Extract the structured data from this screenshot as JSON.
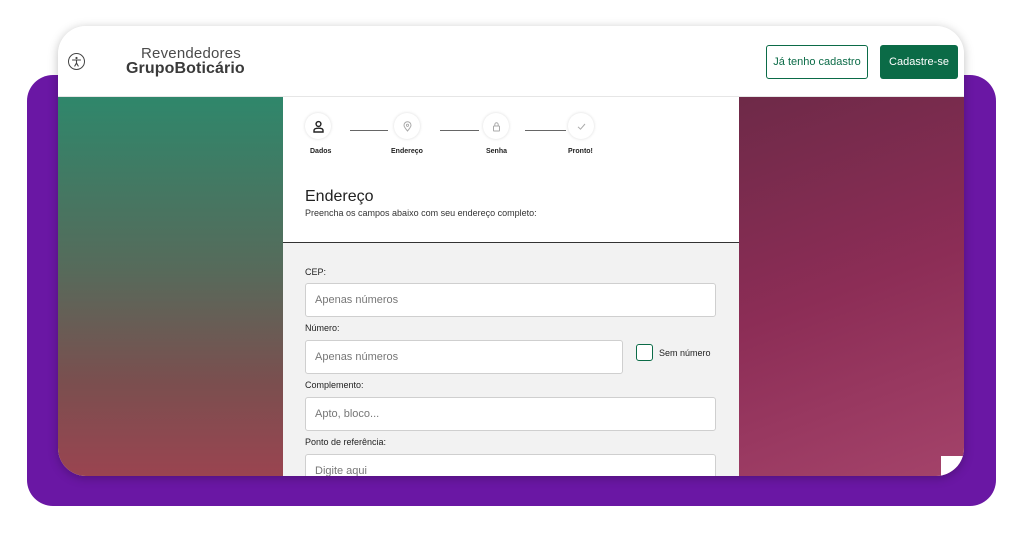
{
  "header": {
    "logo_top": "Revendedores",
    "logo_bottom": "GrupoBoticário",
    "login_button": "Já tenho cadastro",
    "signup_button": "Cadastre-se"
  },
  "stepper": {
    "steps": [
      {
        "label": "Dados",
        "icon": "person-icon",
        "state": "active"
      },
      {
        "label": "Endereço",
        "icon": "location-pin-icon",
        "state": "pending"
      },
      {
        "label": "Senha",
        "icon": "lock-icon",
        "state": "pending"
      },
      {
        "label": "Pronto!",
        "icon": "check-icon",
        "state": "pending"
      }
    ]
  },
  "section": {
    "title": "Endereço",
    "subtitle": "Preencha os campos abaixo com seu endereço completo:"
  },
  "form": {
    "cep": {
      "label": "CEP:",
      "placeholder": "Apenas números"
    },
    "numero": {
      "label": "Número:",
      "placeholder": "Apenas números"
    },
    "sem_numero": {
      "label": "Sem número",
      "checked": false
    },
    "complemento": {
      "label": "Complemento:",
      "placeholder": "Apto, bloco..."
    },
    "referencia": {
      "label": "Ponto de referência:",
      "placeholder": "Digite aqui"
    }
  },
  "colors": {
    "brand_green": "#0b6b47",
    "frame_purple": "#6a17a4"
  }
}
